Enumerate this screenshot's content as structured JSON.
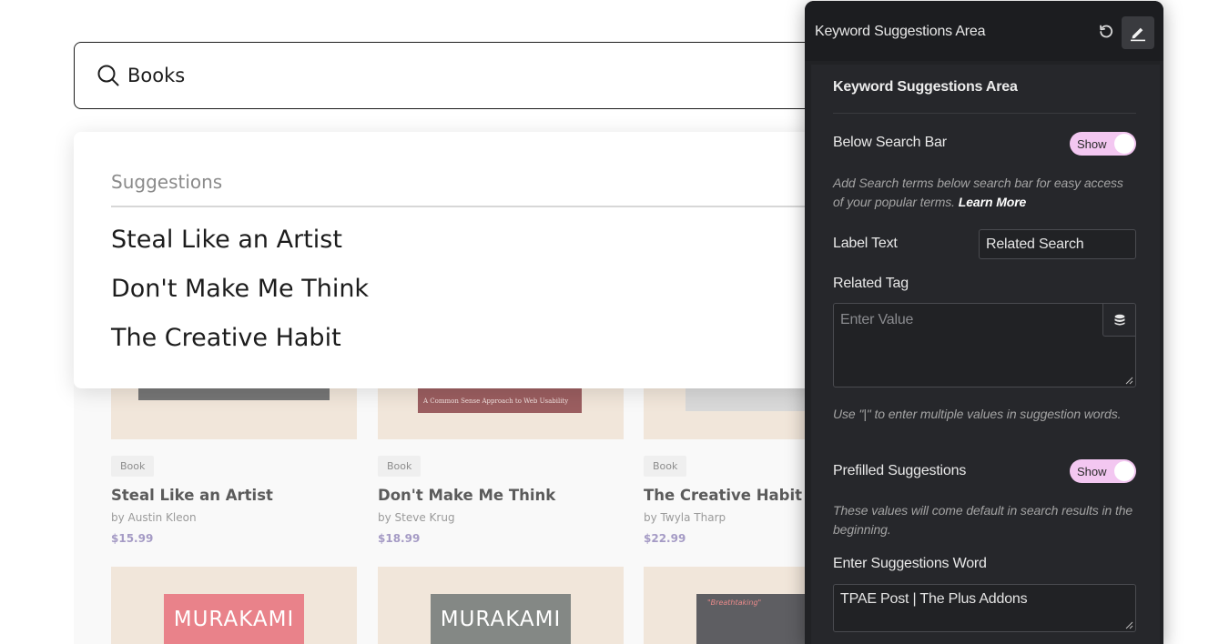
{
  "search": {
    "query": "Books"
  },
  "suggestions": {
    "heading": "Suggestions",
    "items": [
      "Steal Like an Artist",
      "Don't Make Me Think",
      "The Creative Habit"
    ]
  },
  "products": [
    {
      "tag": "Book",
      "title": "Steal Like an Artist",
      "author": "by Austin Kleon",
      "price": "$15.99"
    },
    {
      "tag": "Book",
      "title": "Don't Make Me Think",
      "author": "by Steve Krug",
      "price": "$18.99",
      "cover_text": "A Common Sense Approach to Web Usability"
    },
    {
      "tag": "Book",
      "title": "The Creative Habit",
      "author": "by Twyla Tharp",
      "price": "$22.99"
    }
  ],
  "second_row": [
    {
      "cover_text": "MURAKAMI",
      "color": "#e9828a"
    },
    {
      "cover_text": "MURAKAMI",
      "color": "#848885"
    },
    {
      "cover_text": "\"Breathtaking\"",
      "color": "#5e5e62"
    }
  ],
  "panel": {
    "top_title": "Keyword Suggestions Area",
    "section_title": "Keyword Suggestions Area",
    "below_search_bar": {
      "label": "Below Search Bar",
      "toggle": "Show"
    },
    "help1": "Add Search terms below search bar for easy access of your popular terms.",
    "help1_link": "Learn More",
    "label_text": {
      "label": "Label Text",
      "value": "Related Search"
    },
    "related_tag": {
      "label": "Related Tag",
      "placeholder": "Enter Value"
    },
    "help2": "Use \"|\" to enter multiple values in suggestion words.",
    "prefilled": {
      "label": "Prefilled Suggestions",
      "toggle": "Show"
    },
    "help3": "These values will come default in search results in the beginning.",
    "enter_words": {
      "label": "Enter Suggestions Word",
      "value": "TPAE Post | The Plus Addons"
    }
  },
  "colors": {
    "toggle_bg": "#f3c7f1",
    "panel_bg": "#26272b",
    "price": "#a59bc5"
  }
}
